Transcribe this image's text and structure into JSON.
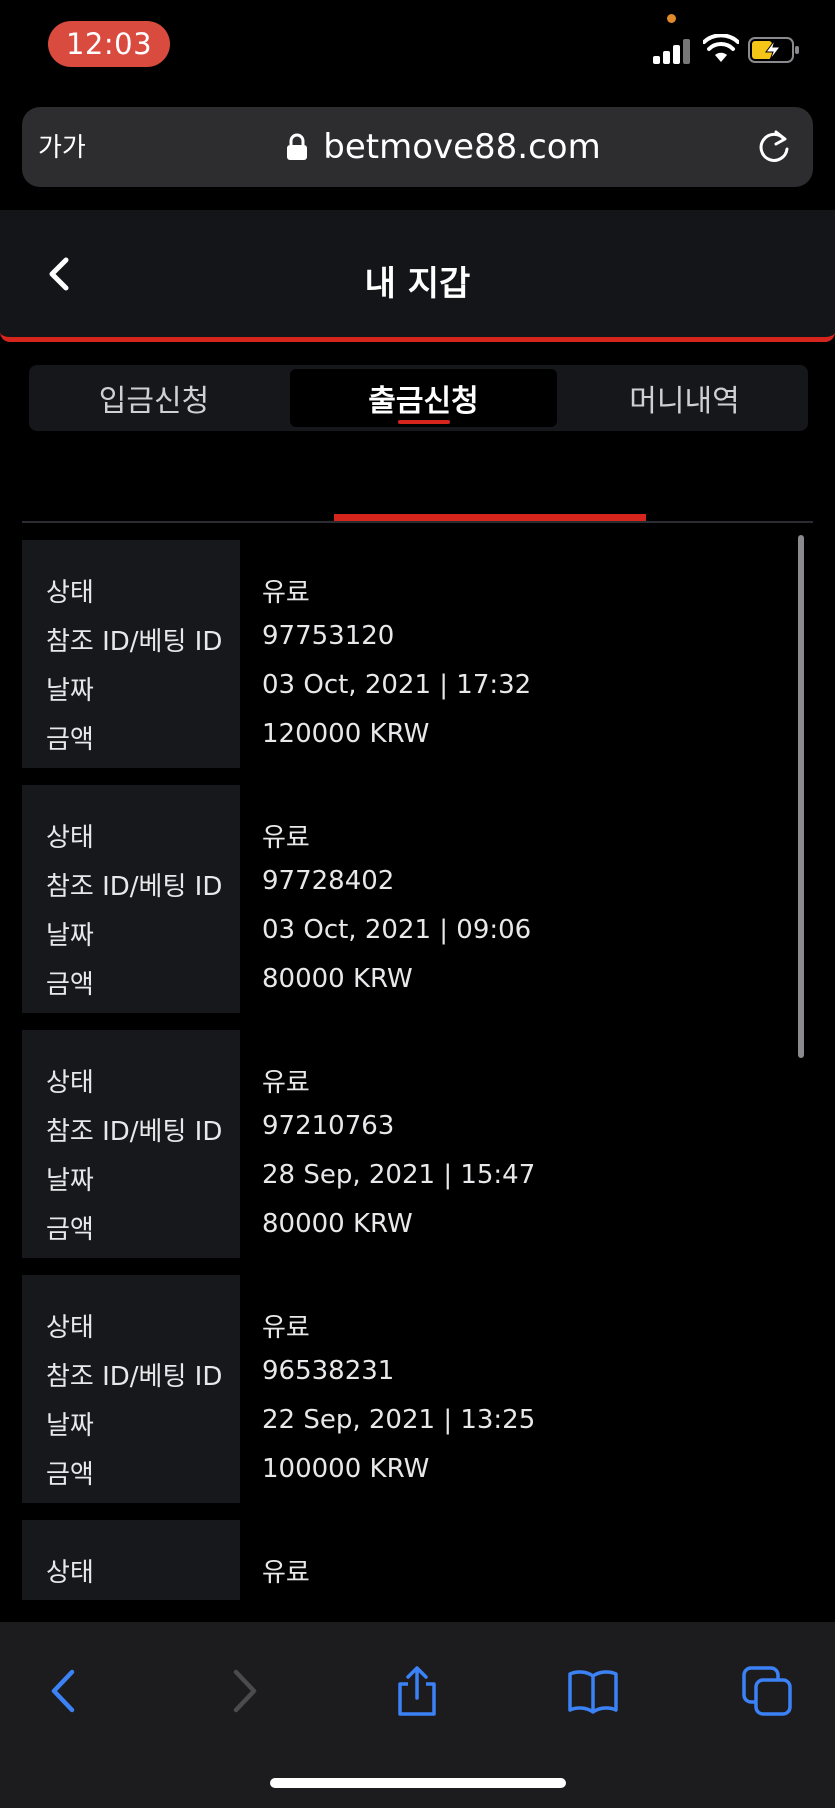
{
  "status_bar": {
    "time": "12:03"
  },
  "browser": {
    "text_size_label": "가가",
    "url": "betmove88.com"
  },
  "header": {
    "title": "내 지갑"
  },
  "tabs": [
    {
      "label": "입금신청",
      "active": false
    },
    {
      "label": "출금신청",
      "active": true
    },
    {
      "label": "머니내역",
      "active": false
    }
  ],
  "records": [
    {
      "status_label": "상태",
      "status": "유료",
      "id_label": "참조 ID/베팅 ID",
      "id": "97753120",
      "date_label": "날짜",
      "date": "03 Oct, 2021 | 17:32",
      "amount_label": "금액",
      "amount": "120000 KRW"
    },
    {
      "status_label": "상태",
      "status": "유료",
      "id_label": "참조 ID/베팅 ID",
      "id": "97728402",
      "date_label": "날짜",
      "date": "03 Oct, 2021 | 09:06",
      "amount_label": "금액",
      "amount": "80000 KRW"
    },
    {
      "status_label": "상태",
      "status": "유료",
      "id_label": "참조 ID/베팅 ID",
      "id": "97210763",
      "date_label": "날짜",
      "date": "28 Sep, 2021 | 15:47",
      "amount_label": "금액",
      "amount": "80000 KRW"
    },
    {
      "status_label": "상태",
      "status": "유료",
      "id_label": "참조 ID/베팅 ID",
      "id": "96538231",
      "date_label": "날짜",
      "date": "22 Sep, 2021 | 13:25",
      "amount_label": "금액",
      "amount": "100000 KRW"
    },
    {
      "status_label": "상태",
      "status": "유료"
    }
  ],
  "colors": {
    "accent": "#d5251d",
    "toolbar_blue": "#3b82f6",
    "time_pill": "#d94a3f"
  },
  "icons": {
    "back": "chevron-left-icon",
    "lock": "lock-icon",
    "reload": "reload-icon",
    "toolbar": [
      "back-arrow-icon",
      "forward-arrow-icon",
      "share-icon",
      "bookmarks-icon",
      "tabs-icon"
    ]
  }
}
